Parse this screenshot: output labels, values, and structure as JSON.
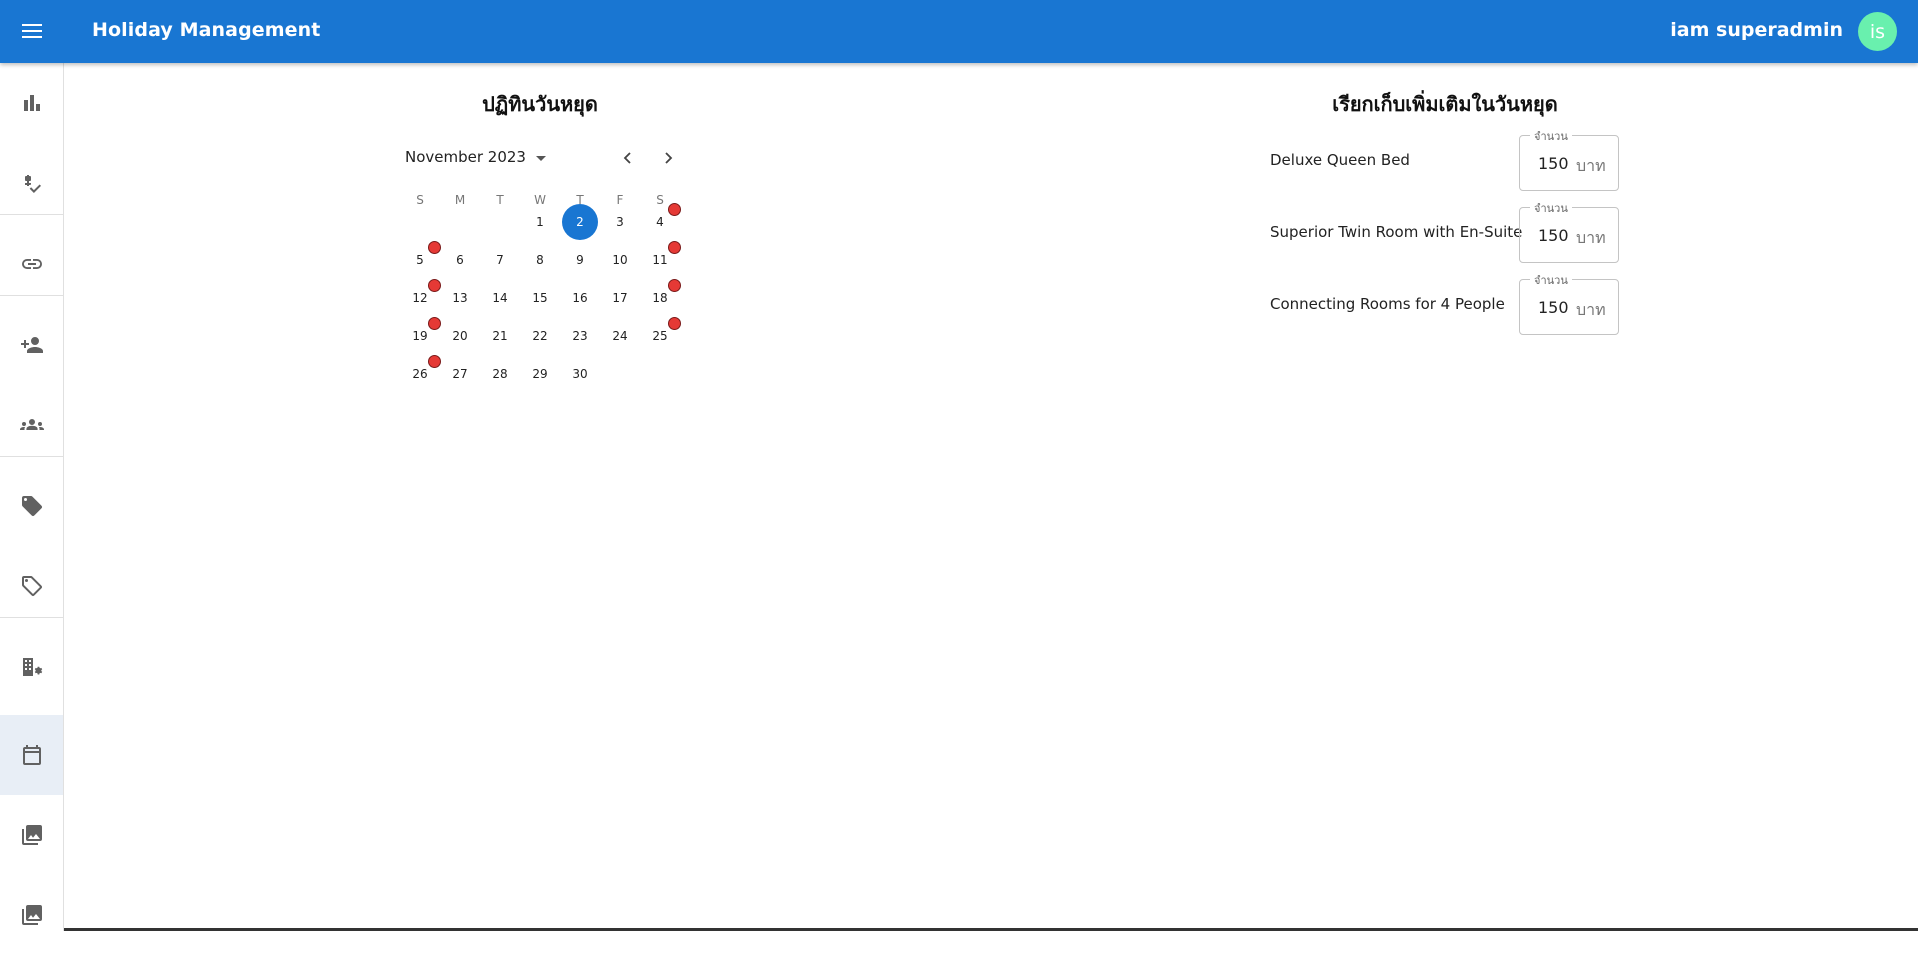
{
  "header": {
    "title": "Holiday Management",
    "user_name": "iam superadmin",
    "avatar_initials": "is",
    "bar_color": "#1976d2",
    "avatar_color": "#69f0ae"
  },
  "sidebar": {
    "items": [
      {
        "icon": "bar-chart-icon",
        "active": false
      },
      {
        "icon": "price-check-icon",
        "active": false
      },
      {
        "icon": "link-icon",
        "active": false
      },
      {
        "icon": "person-add-icon",
        "active": false
      },
      {
        "icon": "groups-icon",
        "active": false
      },
      {
        "icon": "sell-icon",
        "active": false
      },
      {
        "icon": "sell-outline-icon",
        "active": false
      },
      {
        "icon": "building-settings-icon",
        "active": false
      },
      {
        "icon": "calendar-icon",
        "active": true
      },
      {
        "icon": "photo-library-icon",
        "active": false
      },
      {
        "icon": "photo-library-icon",
        "active": false
      }
    ]
  },
  "calendar": {
    "section_title": "ปฏิทินวันหยุด",
    "month_label": "November 2023",
    "weekdays": [
      "S",
      "M",
      "T",
      "W",
      "T",
      "F",
      "S"
    ],
    "first_weekday_index": 3,
    "days_in_month": 30,
    "selected_day": 2,
    "holiday_days": [
      4,
      5,
      11,
      12,
      18,
      19,
      25,
      26
    ],
    "holiday_badge_color": "#e53935",
    "selected_color": "#1976d2"
  },
  "surcharge": {
    "section_title": "เรียกเก็บเพิ่มเติมในวันหยุด",
    "rows": [
      {
        "room": "Deluxe Queen Bed",
        "legend": "จำนวน",
        "value": "150",
        "unit": "บาท"
      },
      {
        "room": "Superior Twin Room with En-Suite",
        "legend": "จำนวน",
        "value": "150",
        "unit": "บาท"
      },
      {
        "room": "Connecting Rooms for 4 People",
        "legend": "จำนวน",
        "value": "150",
        "unit": "บาท"
      }
    ]
  }
}
